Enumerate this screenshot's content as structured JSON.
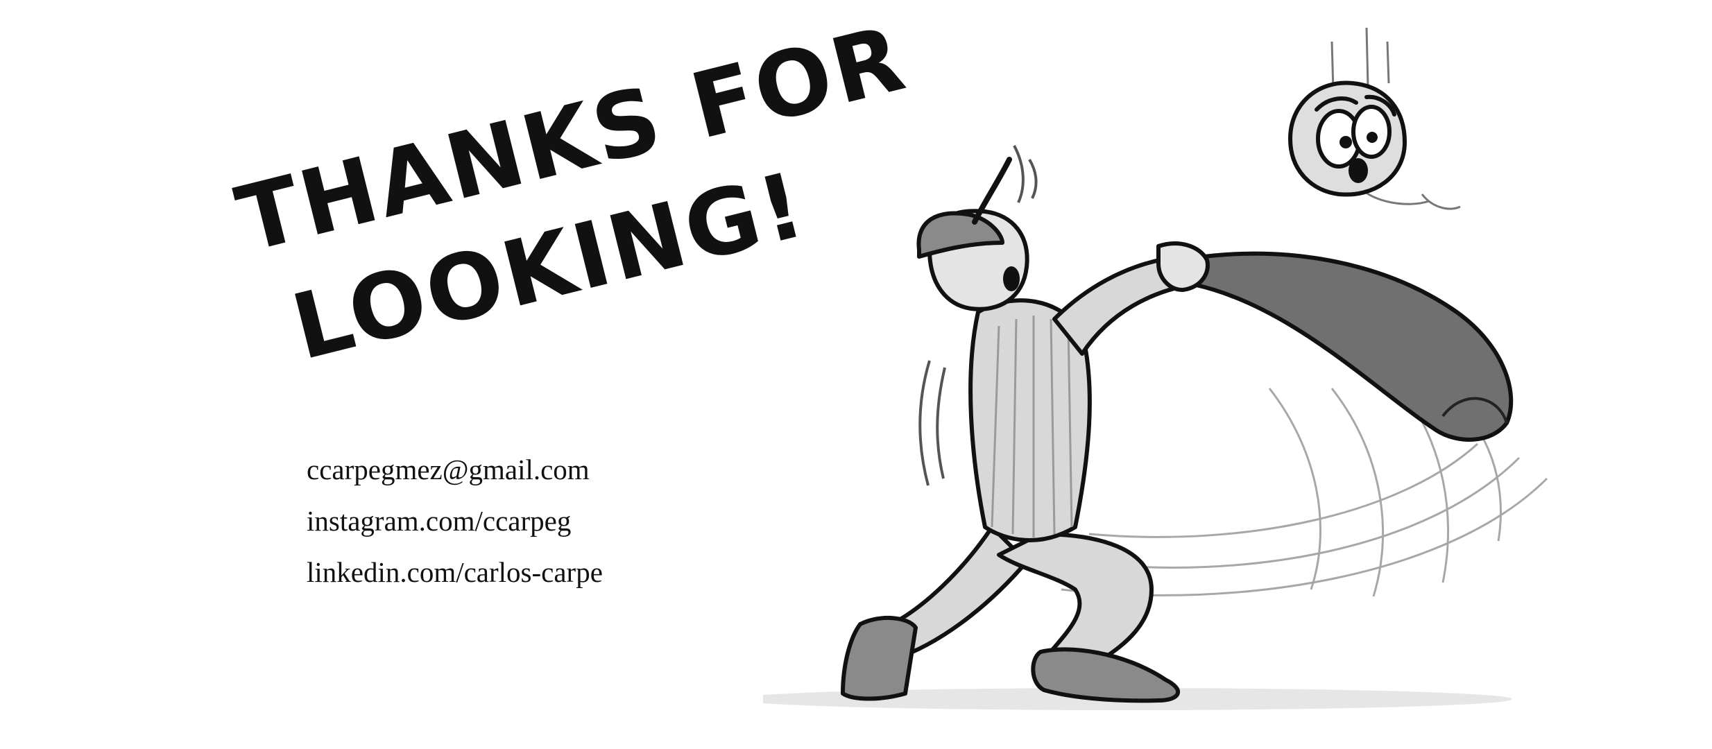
{
  "heading": {
    "line1": "THANKS FOR",
    "line2": "LOOKING!"
  },
  "contact": {
    "email": "ccarpegmez@gmail.com",
    "instagram": "instagram.com/ccarpeg",
    "linkedin": "linkedin.com/carlos-carpe"
  },
  "colors": {
    "ink": "#111111",
    "background": "#ffffff",
    "tone_light": "#d9d9d9",
    "tone_mid": "#9a9a9a",
    "tone_dark": "#6e6e6e"
  }
}
